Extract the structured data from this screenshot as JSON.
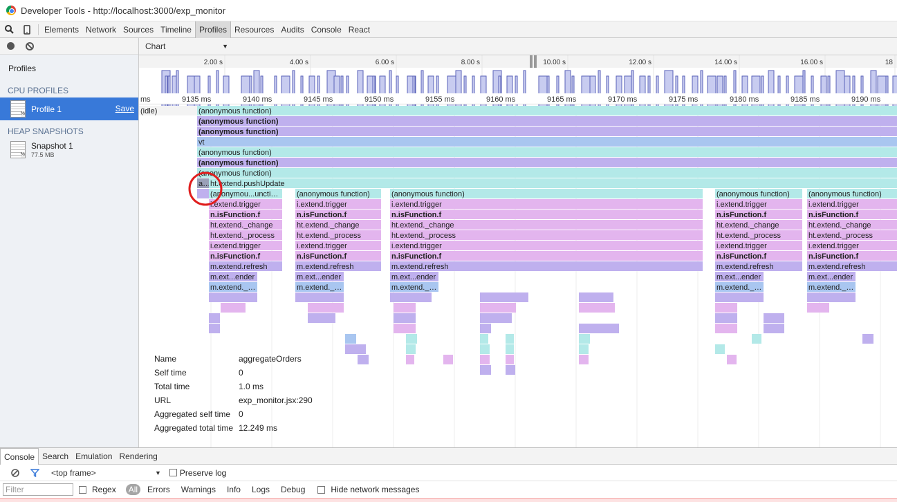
{
  "window": {
    "title": "Developer Tools - http://localhost:3000/exp_monitor"
  },
  "toolbar": {
    "icons": [
      "search-icon",
      "device-icon"
    ],
    "tabs": [
      "Elements",
      "Network",
      "Sources",
      "Timeline",
      "Profiles",
      "Resources",
      "Audits",
      "Console",
      "React"
    ],
    "active_tab": "Profiles"
  },
  "sidebar": {
    "heading": "Profiles",
    "cpu_section": "CPU PROFILES",
    "profile": {
      "name": "Profile 1",
      "save": "Save",
      "icon_badge": "%"
    },
    "heap_section": "HEAP SNAPSHOTS",
    "snapshot": {
      "name": "Snapshot 1",
      "size": "77.5 MB",
      "icon_badge": "%"
    }
  },
  "chart_view": {
    "selected": "Chart"
  },
  "overview_ticks": [
    "2.00 s",
    "4.00 s",
    "6.00 s",
    "8.00 s",
    "10.00 s",
    "12.00 s",
    "14.00 s",
    "16.00 s",
    "18"
  ],
  "ruler_ticks": [
    "ms",
    "9135 ms",
    "9140 ms",
    "9145 ms",
    "9150 ms",
    "9155 ms",
    "9160 ms",
    "9165 ms",
    "9170 ms",
    "9175 ms",
    "9180 ms",
    "9185 ms",
    "9190 ms"
  ],
  "flame_labels": {
    "idle": "(idle)",
    "anon": "(anonymous function)",
    "vt": "vt",
    "push": "ht.extend.pushUpdate",
    "a": "a...",
    "anon_short": "(anonymou...unction)",
    "trigger": "i.extend.trigger",
    "isfn": "n.isFunction.f",
    "change": "ht.extend._change",
    "process": "ht.extend._process",
    "refresh": "m.extend.refresh",
    "render": "m.ext...ender",
    "trs": "m.extend._trs"
  },
  "details": {
    "rows": [
      {
        "key": "Name",
        "value": "aggregateOrders"
      },
      {
        "key": "Self time",
        "value": "0"
      },
      {
        "key": "Total time",
        "value": "1.0 ms"
      },
      {
        "key": "URL",
        "value": "exp_monitor.jsx:290"
      },
      {
        "key": "Aggregated self time",
        "value": "0"
      },
      {
        "key": "Aggregated total time",
        "value": "12.249 ms"
      }
    ]
  },
  "drawer": {
    "tabs": [
      "Console",
      "Search",
      "Emulation",
      "Rendering"
    ],
    "active_tab": "Console",
    "frame": "<top frame>",
    "preserve_log": "Preserve log",
    "filter_placeholder": "Filter",
    "regex": "Regex",
    "levels": [
      "All",
      "Errors",
      "Warnings",
      "Info",
      "Logs",
      "Debug"
    ],
    "hide_network": "Hide network messages"
  },
  "colors": {
    "selected_blue": "#3879d9",
    "annotation_red": "#e01e1e"
  }
}
